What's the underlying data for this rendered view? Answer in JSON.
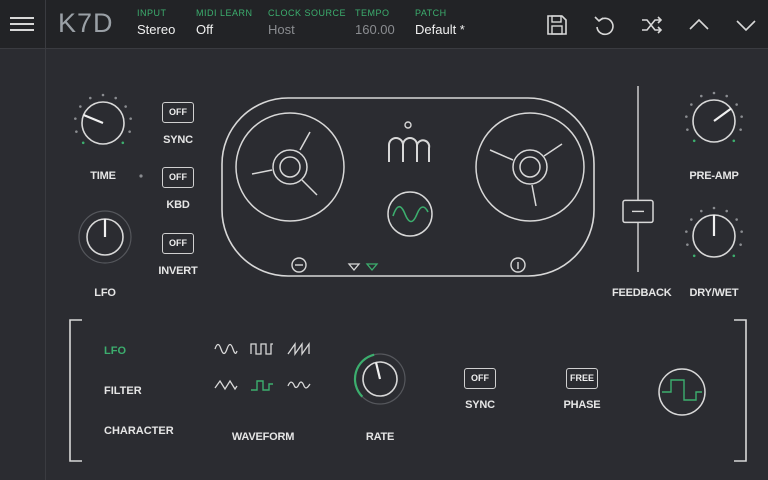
{
  "app": {
    "logo": "K7D"
  },
  "header": {
    "input": {
      "label": "INPUT",
      "value": "Stereo"
    },
    "midi_learn": {
      "label": "MIDI LEARN",
      "value": "Off"
    },
    "clock_source": {
      "label": "CLOCK SOURCE",
      "value": "Host"
    },
    "tempo": {
      "label": "TEMPO",
      "value": "160.00"
    },
    "patch": {
      "label": "PATCH",
      "value": "Default *"
    },
    "icons": [
      "save-icon",
      "undo-icon",
      "shuffle-icon",
      "chevron-up-icon",
      "chevron-down-icon"
    ]
  },
  "controls": {
    "time": {
      "label": "TIME",
      "level": 0.25
    },
    "lfo_knob": {
      "label": "LFO",
      "level": 0.5
    },
    "sync": {
      "label": "SYNC",
      "value": "OFF"
    },
    "kbd": {
      "label": "KBD",
      "value": "OFF"
    },
    "invert": {
      "label": "INVERT",
      "value": "OFF"
    },
    "feedback": {
      "label": "FEEDBACK",
      "level": 0.3
    },
    "pre_amp": {
      "label": "PRE-AMP",
      "level": 0.7
    },
    "dry_wet": {
      "label": "DRY/WET",
      "level": 0.5
    }
  },
  "lfo_panel": {
    "tabs": [
      {
        "label": "LFO",
        "active": true
      },
      {
        "label": "FILTER",
        "active": false
      },
      {
        "label": "CHARACTER",
        "active": false
      }
    ],
    "waveform": {
      "label": "WAVEFORM",
      "selected": "square"
    },
    "rate": {
      "label": "RATE",
      "level": 0.45
    },
    "sync": {
      "label": "SYNC",
      "value": "OFF"
    },
    "phase": {
      "label": "PHASE",
      "value": "FREE"
    }
  },
  "colors": {
    "accent": "#3cae6e",
    "background": "#2b2c31",
    "header": "#222326",
    "line": "#d8d8d8"
  }
}
